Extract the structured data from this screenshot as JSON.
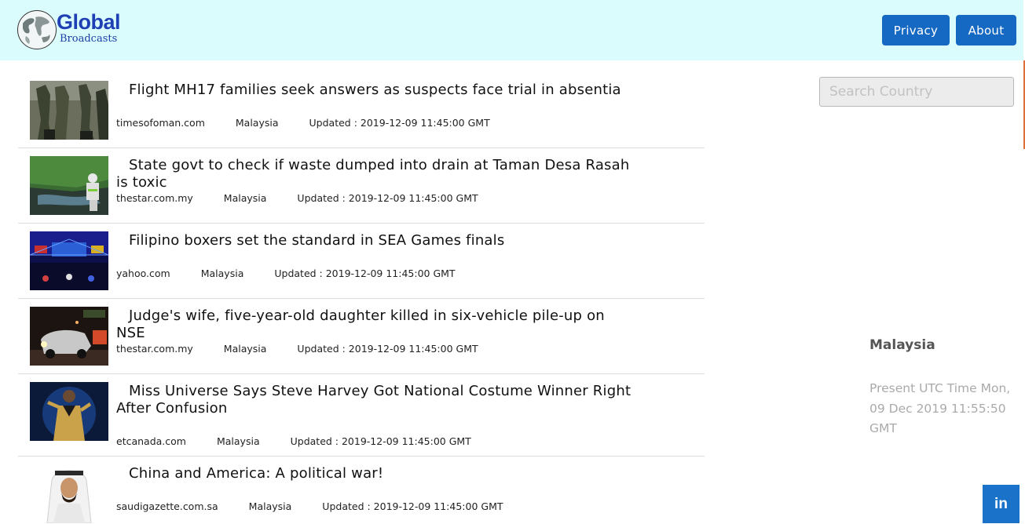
{
  "header": {
    "logo_title": "Global",
    "logo_subtitle": "Broadcasts",
    "nav": {
      "privacy": "Privacy",
      "about": "About"
    }
  },
  "search": {
    "placeholder": "Search Country"
  },
  "sidebar": {
    "country": "Malaysia",
    "time_text": "Present UTC Time Mon, 09 Dec 2019 11:55:50 GMT"
  },
  "articles": [
    {
      "title": "Flight MH17 families seek answers as suspects face trial in absentia",
      "source": "timesofoman.com",
      "country": "Malaysia",
      "updated": "Updated : 2019-12-09 11:45:00 GMT",
      "thumb": "soldiers-photo"
    },
    {
      "title": "State govt to check if waste dumped into drain at Taman Desa Rasah is toxic",
      "source": "thestar.com.my",
      "country": "Malaysia",
      "updated": "Updated : 2019-12-09 11:45:00 GMT",
      "thumb": "drain-worker-photo"
    },
    {
      "title": "Filipino boxers set the standard in SEA Games finals",
      "source": "yahoo.com",
      "country": "Malaysia",
      "updated": "Updated : 2019-12-09 11:45:00 GMT",
      "thumb": "stage-lights-photo"
    },
    {
      "title": "Judge's wife, five-year-old daughter killed in six-vehicle pile-up on NSE",
      "source": "thestar.com.my",
      "country": "Malaysia",
      "updated": "Updated : 2019-12-09 11:45:00 GMT",
      "thumb": "car-crash-photo"
    },
    {
      "title": "Miss Universe Says Steve Harvey Got National Costume Winner Right After Confusion",
      "source": "etcanada.com",
      "country": "Malaysia",
      "updated": "Updated : 2019-12-09 11:45:00 GMT",
      "thumb": "presenter-stage-photo"
    },
    {
      "title": "China and America: A political war!",
      "source": "saudigazette.com.sa",
      "country": "Malaysia",
      "updated": "Updated : 2019-12-09 11:45:00 GMT",
      "thumb": "columnist-portrait"
    }
  ],
  "social": {
    "linkedin_label": "in"
  },
  "colors": {
    "header_bg": "#dbfcfd",
    "nav_button": "#1669c3",
    "linkedin": "#1a73c9",
    "logo_text": "#1f3fb5"
  }
}
